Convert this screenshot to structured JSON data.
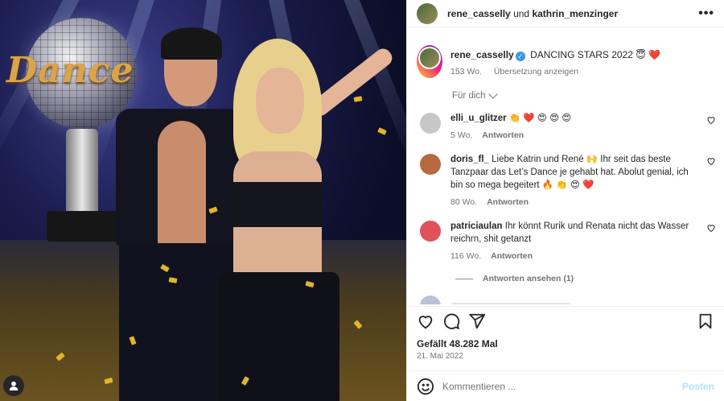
{
  "post_header": {
    "user1": "rene_casselly",
    "conjunction": "und",
    "user2": "kathrin_menzinger",
    "more_icon": "more-dots-icon"
  },
  "caption": {
    "username": "rene_casselly",
    "verified": true,
    "text": "DANCING STARS 2022 😇 ❤️",
    "time": "153 Wo.",
    "translate": "Übersetzung anzeigen"
  },
  "filter": {
    "label": "Für dich"
  },
  "comments": [
    {
      "username": "elli_u_glitzer",
      "text": "👏 ❤️ 😍 😍 😍",
      "time": "5 Wo.",
      "reply": "Antworten",
      "avatar_color": "#c7c7c7"
    },
    {
      "username": "doris_fl_",
      "text": "Liebe Katrin und René 🙌 Ihr seit das beste Tanzpaar das Let’s Dance je gehabt hat. Abolut genial, ich bin so mega begeitert 🔥 👏 😍 ❤️",
      "time": "80 Wo.",
      "reply": "Antworten",
      "avatar_color": "#b76a3f"
    },
    {
      "username": "patriciaulan",
      "text": "Ihr könnt Rurik und Renata nicht das Wasser reichrn, shit getanzt",
      "time": "116 Wo.",
      "reply": "Antworten",
      "avatar_color": "#e1515a"
    }
  ],
  "view_replies": "Antworten ansehen (1)",
  "engagement": {
    "likes": "Gefällt 48.282 Mal",
    "date": "21. Mai 2022"
  },
  "comment_box": {
    "placeholder": "Kommentieren ...",
    "post_label": "Posten"
  },
  "colors": {
    "link_blue": "#3897f0",
    "post_disabled": "#b2dffc",
    "secondary_text": "#737373"
  }
}
